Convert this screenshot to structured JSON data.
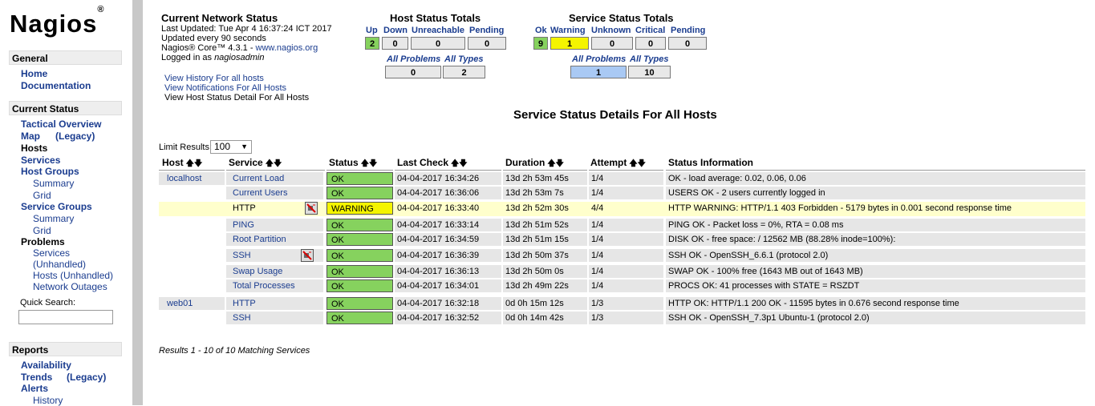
{
  "nav": {
    "logo": "Nagios",
    "logo_mark": "®",
    "general_header": "General",
    "home": "Home",
    "documentation": "Documentation",
    "current_status_header": "Current Status",
    "tactical_overview": "Tactical Overview",
    "map": "Map",
    "legacy1": "(Legacy)",
    "hosts": "Hosts",
    "services": "Services",
    "host_groups": "Host Groups",
    "hg_summary": "Summary",
    "hg_grid": "Grid",
    "service_groups": "Service Groups",
    "sg_summary": "Summary",
    "sg_grid": "Grid",
    "problems": "Problems",
    "p_services": "Services",
    "p_unhandled": "(Unhandled)",
    "p_hosts_unhandled": "Hosts (Unhandled)",
    "p_network_outages": "Network Outages",
    "quick_search": "Quick Search:",
    "reports_header": "Reports",
    "availability": "Availability",
    "trends": "Trends",
    "legacy2": "(Legacy)",
    "alerts": "Alerts",
    "history": "History"
  },
  "info": {
    "title": "Current Network Status",
    "last_updated": "Last Updated: Tue Apr 4 16:37:24 ICT 2017",
    "update_every": "Updated every 90 seconds",
    "core_prefix": "Nagios® Core™ 4.3.1 - ",
    "core_link": "www.nagios.org",
    "logged_prefix": "Logged in as ",
    "logged_user": "nagiosadmin",
    "link1": "View History For all hosts",
    "link2": "View Notifications For All Hosts",
    "link3": "View Host Status Detail For All Hosts"
  },
  "host_totals": {
    "title": "Host Status Totals",
    "headers": [
      "Up",
      "Down",
      "Unreachable",
      "Pending"
    ],
    "values": [
      "2",
      "0",
      "0",
      "0"
    ],
    "all_problems": "All Problems",
    "all_types": "All Types",
    "problems_value": "0",
    "types_value": "2"
  },
  "service_totals": {
    "title": "Service Status Totals",
    "headers": [
      "Ok",
      "Warning",
      "Unknown",
      "Critical",
      "Pending"
    ],
    "values": [
      "9",
      "1",
      "0",
      "0",
      "0"
    ],
    "all_problems": "All Problems",
    "all_types": "All Types",
    "problems_value": "1",
    "types_value": "10"
  },
  "page_title": "Service Status Details For All Hosts",
  "limit_label": "Limit Results:",
  "limit_value": "100",
  "columns": [
    "Host",
    "Service",
    "Status",
    "Last Check",
    "Duration",
    "Attempt",
    "Status Information"
  ],
  "rows": [
    {
      "host": "localhost",
      "service": "Current Load",
      "status": "OK",
      "last_check": "04-04-2017 16:34:26",
      "duration": "13d 2h 53m 45s",
      "attempt": "1/4",
      "info": "OK - load average: 0.02, 0.06, 0.06"
    },
    {
      "host": "",
      "service": "Current Users",
      "status": "OK",
      "last_check": "04-04-2017 16:36:06",
      "duration": "13d 2h 53m 7s",
      "attempt": "1/4",
      "info": "USERS OK - 2 users currently logged in"
    },
    {
      "host": "",
      "service": "HTTP",
      "status": "WARNING",
      "last_check": "04-04-2017 16:33:40",
      "duration": "13d 2h 52m 30s",
      "attempt": "4/4",
      "info": "HTTP WARNING: HTTP/1.1 403 Forbidden - 5179 bytes in 0.001 second response time"
    },
    {
      "host": "",
      "service": "PING",
      "status": "OK",
      "last_check": "04-04-2017 16:33:14",
      "duration": "13d 2h 51m 52s",
      "attempt": "1/4",
      "info": "PING OK - Packet loss = 0%, RTA = 0.08 ms"
    },
    {
      "host": "",
      "service": "Root Partition",
      "status": "OK",
      "last_check": "04-04-2017 16:34:59",
      "duration": "13d 2h 51m 15s",
      "attempt": "1/4",
      "info": "DISK OK - free space: / 12562 MB (88.28% inode=100%):"
    },
    {
      "host": "",
      "service": "SSH",
      "status": "OK",
      "last_check": "04-04-2017 16:36:39",
      "duration": "13d 2h 50m 37s",
      "attempt": "1/4",
      "info": "SSH OK - OpenSSH_6.6.1 (protocol 2.0)"
    },
    {
      "host": "",
      "service": "Swap Usage",
      "status": "OK",
      "last_check": "04-04-2017 16:36:13",
      "duration": "13d 2h 50m 0s",
      "attempt": "1/4",
      "info": "SWAP OK - 100% free (1643 MB out of 1643 MB)"
    },
    {
      "host": "",
      "service": "Total Processes",
      "status": "OK",
      "last_check": "04-04-2017 16:34:01",
      "duration": "13d 2h 49m 22s",
      "attempt": "1/4",
      "info": "PROCS OK: 41 processes with STATE = RSZDT"
    },
    {
      "host": "web01",
      "service": "HTTP",
      "status": "OK",
      "last_check": "04-04-2017 16:32:18",
      "duration": "0d 0h 15m 12s",
      "attempt": "1/3",
      "info": "HTTP OK: HTTP/1.1 200 OK - 11595 bytes in 0.676 second response time"
    },
    {
      "host": "",
      "service": "SSH",
      "status": "OK",
      "last_check": "04-04-2017 16:32:52",
      "duration": "0d 0h 14m 42s",
      "attempt": "1/3",
      "info": "SSH OK - OpenSSH_7.3p1 Ubuntu-1 (protocol 2.0)"
    }
  ],
  "results_text": "Results 1 - 10 of 10 Matching Services",
  "colors": {
    "ok": "#86d25e",
    "warning": "#f4f400",
    "problems_blue": "#a9c9f4",
    "link": "#1a3c8f"
  },
  "icons": {
    "notifications_disabled": "no-notify-icon"
  }
}
